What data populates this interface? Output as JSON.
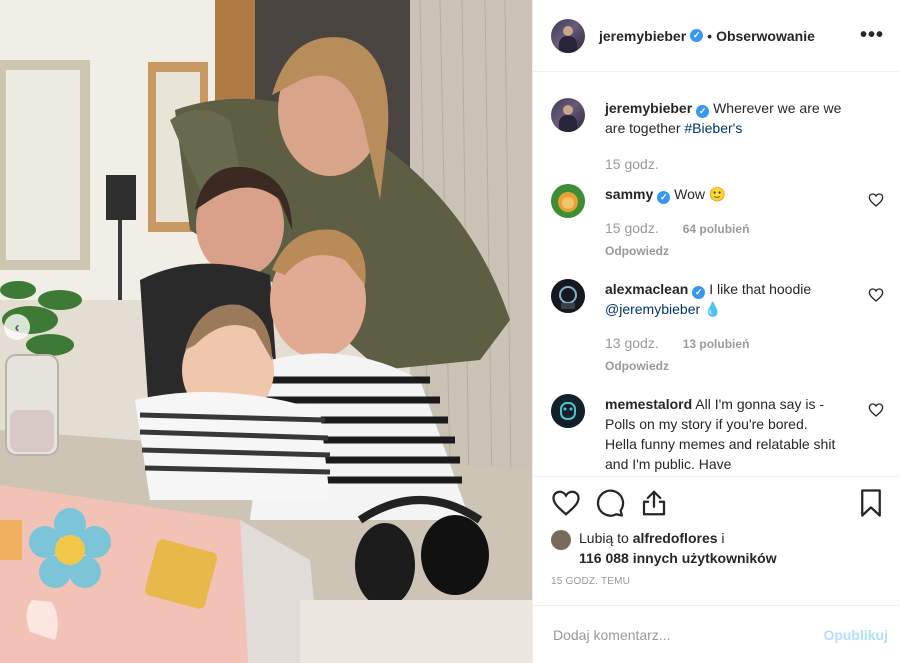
{
  "post": {
    "author": "jeremybieber",
    "follow_separator": "•",
    "follow_label": "Obserwowanie",
    "more_label": "•••",
    "carousel_prev": "‹"
  },
  "caption": {
    "user": "jeremybieber",
    "text": "Wherever we are we are together",
    "hashtag": "#Bieber's",
    "time": "15 godz."
  },
  "comments": [
    {
      "user": "sammy",
      "verified": true,
      "text": "Wow 🙂",
      "time": "15 godz.",
      "likes": "64 polubień",
      "reply": "Odpowiedz"
    },
    {
      "user": "alexmaclean",
      "verified": true,
      "text": "I like that hoodie",
      "mention": "@jeremybieber",
      "emoji": "💧",
      "time": "13 godz.",
      "likes": "13 polubień",
      "reply": "Odpowiedz"
    },
    {
      "user": "memestalord",
      "verified": false,
      "text": "All I'm gonna say is - Polls on my story if you're bored. Hella funny memes and relatable shit and I'm public. Have"
    }
  ],
  "likes": {
    "prefix": "Lubią to",
    "first_user": "alfredoflores",
    "joiner": "i",
    "others": "116 088 innych użytkowników"
  },
  "timeago": "15 GODZ. TEMU",
  "add_comment": {
    "placeholder": "Dodaj komentarz...",
    "publish_label": "Opublikuj"
  },
  "colors": {
    "verified": "#3897f0",
    "link": "#003569",
    "muted": "#999999",
    "publish_disabled": "#b2dffc"
  }
}
